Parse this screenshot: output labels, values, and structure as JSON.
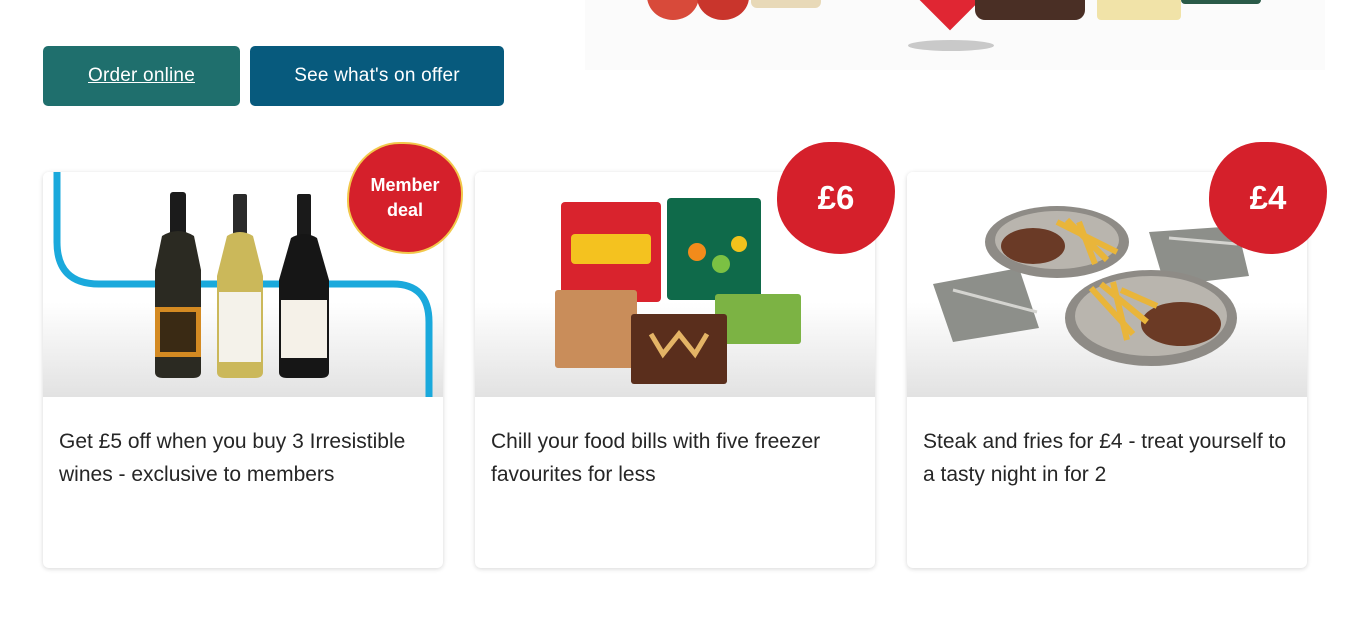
{
  "colors": {
    "order_button": "#1f6f6d",
    "offer_button": "#075a7d",
    "badge_red": "#d5202b",
    "member_badge_border": "#f2c84b",
    "wine_line": "#1aa9dc"
  },
  "actions": {
    "order_online": "Order online",
    "see_offers": "See what's on offer"
  },
  "cards": [
    {
      "image": "wine-bottles-image",
      "badge": "Member deal",
      "text": "Get £5 off when you buy 3 Irresistible wines - exclusive to members"
    },
    {
      "image": "frozen-food-image",
      "badge": "£6",
      "text": "Chill your food bills with five freezer favourites for less"
    },
    {
      "image": "steak-and-fries-image",
      "badge": "£4",
      "text": "Steak and fries for £4 - treat yourself to a tasty night in for 2"
    }
  ]
}
